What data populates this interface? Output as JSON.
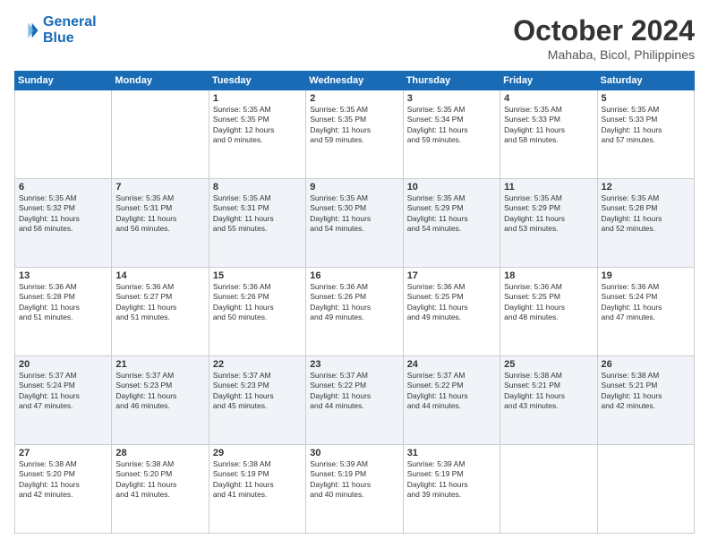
{
  "header": {
    "logo_line1": "General",
    "logo_line2": "Blue",
    "month": "October 2024",
    "location": "Mahaba, Bicol, Philippines"
  },
  "weekdays": [
    "Sunday",
    "Monday",
    "Tuesday",
    "Wednesday",
    "Thursday",
    "Friday",
    "Saturday"
  ],
  "weeks": [
    [
      {
        "day": "",
        "info": ""
      },
      {
        "day": "",
        "info": ""
      },
      {
        "day": "1",
        "info": "Sunrise: 5:35 AM\nSunset: 5:35 PM\nDaylight: 12 hours\nand 0 minutes."
      },
      {
        "day": "2",
        "info": "Sunrise: 5:35 AM\nSunset: 5:35 PM\nDaylight: 11 hours\nand 59 minutes."
      },
      {
        "day": "3",
        "info": "Sunrise: 5:35 AM\nSunset: 5:34 PM\nDaylight: 11 hours\nand 59 minutes."
      },
      {
        "day": "4",
        "info": "Sunrise: 5:35 AM\nSunset: 5:33 PM\nDaylight: 11 hours\nand 58 minutes."
      },
      {
        "day": "5",
        "info": "Sunrise: 5:35 AM\nSunset: 5:33 PM\nDaylight: 11 hours\nand 57 minutes."
      }
    ],
    [
      {
        "day": "6",
        "info": "Sunrise: 5:35 AM\nSunset: 5:32 PM\nDaylight: 11 hours\nand 56 minutes."
      },
      {
        "day": "7",
        "info": "Sunrise: 5:35 AM\nSunset: 5:31 PM\nDaylight: 11 hours\nand 56 minutes."
      },
      {
        "day": "8",
        "info": "Sunrise: 5:35 AM\nSunset: 5:31 PM\nDaylight: 11 hours\nand 55 minutes."
      },
      {
        "day": "9",
        "info": "Sunrise: 5:35 AM\nSunset: 5:30 PM\nDaylight: 11 hours\nand 54 minutes."
      },
      {
        "day": "10",
        "info": "Sunrise: 5:35 AM\nSunset: 5:29 PM\nDaylight: 11 hours\nand 54 minutes."
      },
      {
        "day": "11",
        "info": "Sunrise: 5:35 AM\nSunset: 5:29 PM\nDaylight: 11 hours\nand 53 minutes."
      },
      {
        "day": "12",
        "info": "Sunrise: 5:35 AM\nSunset: 5:28 PM\nDaylight: 11 hours\nand 52 minutes."
      }
    ],
    [
      {
        "day": "13",
        "info": "Sunrise: 5:36 AM\nSunset: 5:28 PM\nDaylight: 11 hours\nand 51 minutes."
      },
      {
        "day": "14",
        "info": "Sunrise: 5:36 AM\nSunset: 5:27 PM\nDaylight: 11 hours\nand 51 minutes."
      },
      {
        "day": "15",
        "info": "Sunrise: 5:36 AM\nSunset: 5:26 PM\nDaylight: 11 hours\nand 50 minutes."
      },
      {
        "day": "16",
        "info": "Sunrise: 5:36 AM\nSunset: 5:26 PM\nDaylight: 11 hours\nand 49 minutes."
      },
      {
        "day": "17",
        "info": "Sunrise: 5:36 AM\nSunset: 5:25 PM\nDaylight: 11 hours\nand 49 minutes."
      },
      {
        "day": "18",
        "info": "Sunrise: 5:36 AM\nSunset: 5:25 PM\nDaylight: 11 hours\nand 48 minutes."
      },
      {
        "day": "19",
        "info": "Sunrise: 5:36 AM\nSunset: 5:24 PM\nDaylight: 11 hours\nand 47 minutes."
      }
    ],
    [
      {
        "day": "20",
        "info": "Sunrise: 5:37 AM\nSunset: 5:24 PM\nDaylight: 11 hours\nand 47 minutes."
      },
      {
        "day": "21",
        "info": "Sunrise: 5:37 AM\nSunset: 5:23 PM\nDaylight: 11 hours\nand 46 minutes."
      },
      {
        "day": "22",
        "info": "Sunrise: 5:37 AM\nSunset: 5:23 PM\nDaylight: 11 hours\nand 45 minutes."
      },
      {
        "day": "23",
        "info": "Sunrise: 5:37 AM\nSunset: 5:22 PM\nDaylight: 11 hours\nand 44 minutes."
      },
      {
        "day": "24",
        "info": "Sunrise: 5:37 AM\nSunset: 5:22 PM\nDaylight: 11 hours\nand 44 minutes."
      },
      {
        "day": "25",
        "info": "Sunrise: 5:38 AM\nSunset: 5:21 PM\nDaylight: 11 hours\nand 43 minutes."
      },
      {
        "day": "26",
        "info": "Sunrise: 5:38 AM\nSunset: 5:21 PM\nDaylight: 11 hours\nand 42 minutes."
      }
    ],
    [
      {
        "day": "27",
        "info": "Sunrise: 5:38 AM\nSunset: 5:20 PM\nDaylight: 11 hours\nand 42 minutes."
      },
      {
        "day": "28",
        "info": "Sunrise: 5:38 AM\nSunset: 5:20 PM\nDaylight: 11 hours\nand 41 minutes."
      },
      {
        "day": "29",
        "info": "Sunrise: 5:38 AM\nSunset: 5:19 PM\nDaylight: 11 hours\nand 41 minutes."
      },
      {
        "day": "30",
        "info": "Sunrise: 5:39 AM\nSunset: 5:19 PM\nDaylight: 11 hours\nand 40 minutes."
      },
      {
        "day": "31",
        "info": "Sunrise: 5:39 AM\nSunset: 5:19 PM\nDaylight: 11 hours\nand 39 minutes."
      },
      {
        "day": "",
        "info": ""
      },
      {
        "day": "",
        "info": ""
      }
    ]
  ]
}
